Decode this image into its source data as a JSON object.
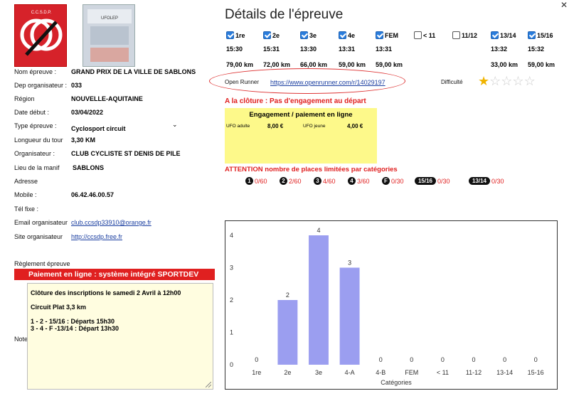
{
  "colors": {
    "accent_red": "#e02020",
    "checkbox_blue": "#2a7ddc",
    "bar_color": "#9b9ef0",
    "yellow_box": "#fdf98a"
  },
  "logo1": {
    "text": "C.C.S.D.P."
  },
  "logo2": {
    "text": "UFOLEP"
  },
  "page_title": "Détails de l'épreuve",
  "info": [
    {
      "label": "Nom épreuve :",
      "value": "GRAND PRIX DE LA VILLE DE SABLONS"
    },
    {
      "label": "Dep organisateur :",
      "value": "033"
    },
    {
      "label": "Région",
      "value": "NOUVELLE-AQUITAINE"
    },
    {
      "label": "Date début :",
      "value": "03/04/2022"
    },
    {
      "label": "Type épreuve :",
      "value": "Cyclosport circuit"
    },
    {
      "label": "Longueur du tour",
      "value": "3,30 KM"
    },
    {
      "label": "Organisateur :",
      "value": "CLUB CYCLISTE ST DENIS DE PILE"
    },
    {
      "label": "Lieu de la manif",
      "value": "SABLONS"
    },
    {
      "label": "Adresse",
      "value": ""
    },
    {
      "label": "Mobile :",
      "value": "06.42.46.00.57"
    },
    {
      "label": "Tél fixe :",
      "value": ""
    },
    {
      "label": "Email organisateur",
      "value": "club.ccsdp33910@orange.fr"
    },
    {
      "label": "Site organisateur",
      "value": "http://ccsdp.free.fr"
    }
  ],
  "reglement_label": "Règlement épreuve",
  "banner": "Paiement en ligne : système intégré SPORTDEV",
  "note_label": "Note",
  "note_lines": [
    "Clôture des inscriptions le samedi 2 Avril à 12h00",
    "",
    "Circuit Plat 3,3 km",
    "",
    "1 - 2 - 15/16  : Départs 15h30",
    "3 - 4 - F -13/14  : Départ 13h30"
  ],
  "categories": [
    {
      "label": "1re",
      "checked": true,
      "time": "15:30",
      "km": "79,00 km"
    },
    {
      "label": "2e",
      "checked": true,
      "time": "15:31",
      "km": "72,00 km"
    },
    {
      "label": "3e",
      "checked": true,
      "time": "13:30",
      "km": "66,00 km"
    },
    {
      "label": "4e",
      "checked": true,
      "time": "13:31",
      "km": "59,00 km"
    },
    {
      "label": "FEM",
      "checked": true,
      "time": "13:31",
      "km": "59,00 km"
    },
    {
      "label": "< 11",
      "checked": false,
      "time": "",
      "km": ""
    },
    {
      "label": "11/12",
      "checked": false,
      "time": "",
      "km": ""
    },
    {
      "label": "13/14",
      "checked": true,
      "time": "13:32",
      "km": "33,00 km"
    },
    {
      "label": "15/16",
      "checked": true,
      "time": "15:32",
      "km": "59,00 km"
    }
  ],
  "open_runner": {
    "label": "Open Runner",
    "url": "https://www.openrunner.com/r/14029197"
  },
  "difficulte": {
    "label": "Difficulté",
    "stars_filled": 1,
    "stars_total": 5
  },
  "cloture": "A  la clôture :   Pas d'engagement au départ",
  "engagement": {
    "title": "Engagement / paiement en ligne",
    "ufo_adulte_label": "UFO adulte",
    "ufo_adulte_price": "8,00 €",
    "ufo_jeune_label": "UFO jeune",
    "ufo_jeune_price": "4,00 €"
  },
  "attention": "ATTENTION nombre de places limitées par catégories",
  "places": [
    {
      "badge": "1",
      "count": "0/60"
    },
    {
      "badge": "2",
      "count": "2/60"
    },
    {
      "badge": "3",
      "count": "4/60"
    },
    {
      "badge": "4",
      "count": "3/60"
    },
    {
      "badge": "F",
      "count": "0/30"
    },
    {
      "badge": "15/16",
      "count": "0/30"
    },
    {
      "badge": "13/14",
      "count": "0/30"
    }
  ],
  "chart_data": {
    "type": "bar",
    "categories": [
      "1re",
      "2e",
      "3e",
      "4-A",
      "4-B",
      "FEM",
      "< 11",
      "11-12",
      "13-14",
      "15-16"
    ],
    "values": [
      0,
      2,
      4,
      3,
      0,
      0,
      0,
      0,
      0,
      0
    ],
    "xlabel": "Catégories",
    "ylabel": "",
    "ylim": [
      0,
      4
    ],
    "yticks": [
      "0",
      "1",
      "2",
      "3",
      "4"
    ],
    "grid": false
  },
  "close_icon": "✕"
}
